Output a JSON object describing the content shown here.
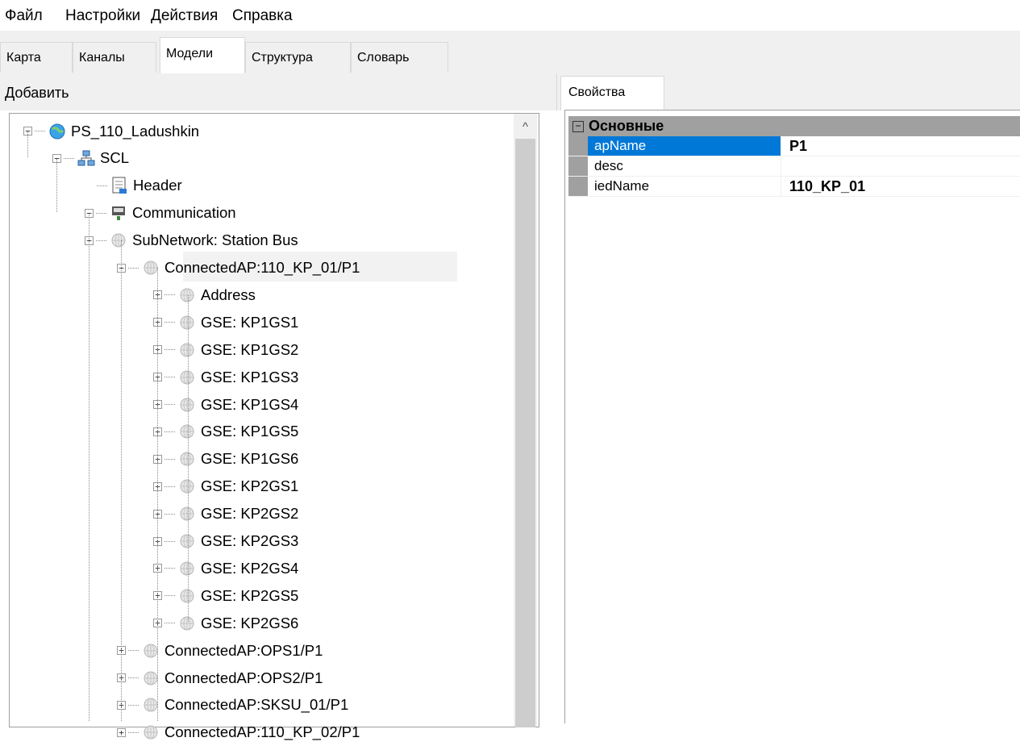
{
  "menu": [
    "Файл",
    "Настройки",
    "Действия",
    "Справка"
  ],
  "tabs": [
    "Карта",
    "Каналы",
    "Модели",
    "Структура",
    "Словарь"
  ],
  "active_tab": "Модели",
  "left_panel": {
    "header": "Добавить"
  },
  "tree": [
    {
      "label": "PS_110_Ladushkin",
      "expander": "−",
      "icon": "globe-icon"
    },
    {
      "label": "SCL",
      "expander": "−",
      "icon": "network-icon"
    },
    {
      "label": "Header",
      "expander": "",
      "icon": "document-icon"
    },
    {
      "label": "Communication",
      "expander": "−",
      "icon": "network-card-icon"
    },
    {
      "label": "SubNetwork: Station Bus",
      "expander": "−",
      "icon": "subnet-icon"
    },
    {
      "label": "ConnectedAP:110_KP_01/P1",
      "expander": "−",
      "icon": "subnet-icon"
    },
    {
      "label": "Address",
      "expander": "+",
      "icon": "subnet-icon"
    },
    {
      "label": "GSE: KP1GS1",
      "expander": "+",
      "icon": "subnet-icon"
    },
    {
      "label": "GSE: KP1GS2",
      "expander": "+",
      "icon": "subnet-icon"
    },
    {
      "label": "GSE: KP1GS3",
      "expander": "+",
      "icon": "subnet-icon"
    },
    {
      "label": "GSE: KP1GS4",
      "expander": "+",
      "icon": "subnet-icon"
    },
    {
      "label": "GSE: KP1GS5",
      "expander": "+",
      "icon": "subnet-icon"
    },
    {
      "label": "GSE: KP1GS6",
      "expander": "+",
      "icon": "subnet-icon"
    },
    {
      "label": "GSE: KP2GS1",
      "expander": "+",
      "icon": "subnet-icon"
    },
    {
      "label": "GSE: KP2GS2",
      "expander": "+",
      "icon": "subnet-icon"
    },
    {
      "label": "GSE: KP2GS3",
      "expander": "+",
      "icon": "subnet-icon"
    },
    {
      "label": "GSE: KP2GS4",
      "expander": "+",
      "icon": "subnet-icon"
    },
    {
      "label": "GSE: KP2GS5",
      "expander": "+",
      "icon": "subnet-icon"
    },
    {
      "label": "GSE: KP2GS6",
      "expander": "+",
      "icon": "subnet-icon"
    },
    {
      "label": "ConnectedAP:OPS1/P1",
      "expander": "+",
      "icon": "subnet-icon"
    },
    {
      "label": "ConnectedAP:OPS2/P1",
      "expander": "+",
      "icon": "subnet-icon"
    },
    {
      "label": "ConnectedAP:SKSU_01/P1",
      "expander": "+",
      "icon": "subnet-icon"
    },
    {
      "label": "ConnectedAP:110_KP_02/P1",
      "expander": "+",
      "icon": "subnet-icon"
    }
  ],
  "right_panel": {
    "tab": "Свойства",
    "category": "Основные",
    "category_expander": "−",
    "properties": [
      {
        "name": "apName",
        "value": "P1"
      },
      {
        "name": "desc",
        "value": ""
      },
      {
        "name": "iedName",
        "value": "110_KP_01"
      }
    ]
  },
  "colors": {
    "selection": "#0078d7",
    "grid_gutter": "#a0a0a0",
    "panel_bg": "#f0f0f0"
  }
}
